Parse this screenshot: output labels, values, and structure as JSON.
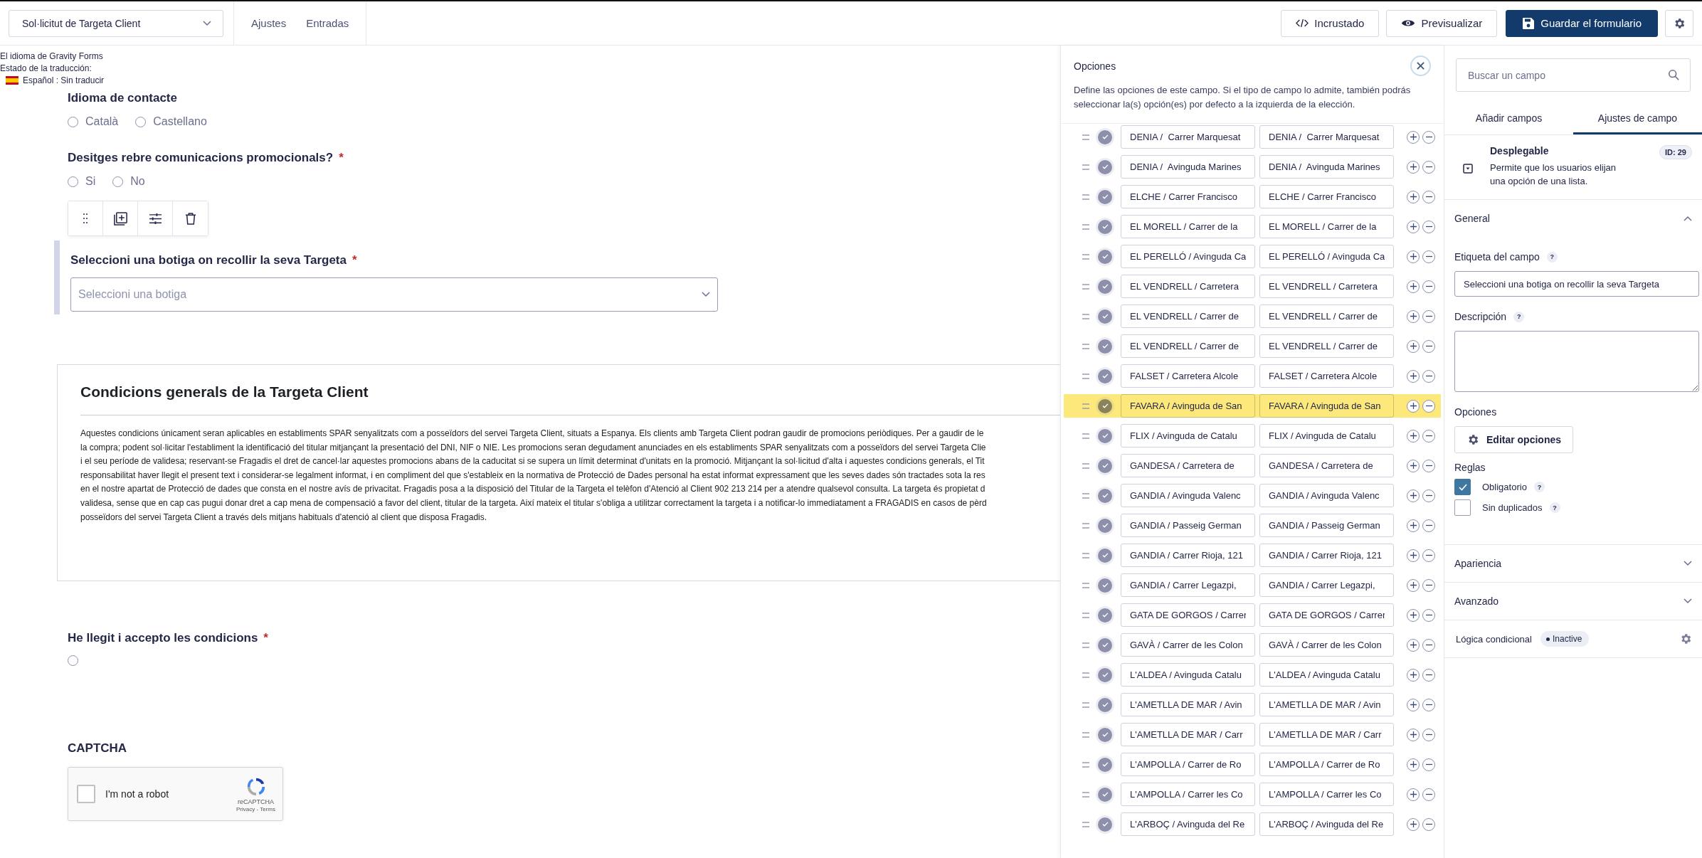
{
  "top_bar": {
    "form_selector": "Sol·licitut de Targeta Client",
    "nav": [
      {
        "label": "Ajustes"
      },
      {
        "label": "Entradas"
      }
    ],
    "buttons": [
      {
        "kind": "embed",
        "label": "Incrustado"
      },
      {
        "kind": "preview",
        "label": "Previsualizar"
      },
      {
        "kind": "save",
        "label": "Guardar el formulario"
      }
    ]
  },
  "translation_info": {
    "language_line": "El idioma de Gravity Forms",
    "status_label": "Estado de la traducción:",
    "status": "Español : Sin traducir"
  },
  "form": {
    "fields": [
      {
        "kind": "radio",
        "label": "Idioma de contacte",
        "selected": false,
        "options": [
          {
            "label": "Català",
            "selected": false
          },
          {
            "label": "Castellano",
            "selected": false
          }
        ]
      },
      {
        "kind": "radio",
        "label": "Desitges rebre comunicacions promocionals?",
        "required_mark": "*",
        "selected": false,
        "options": [
          {
            "label": "Si",
            "selected": false
          },
          {
            "label": "No",
            "selected": false
          }
        ]
      },
      {
        "kind": "select",
        "label": "Seleccioni una botiga on recollir la seva Targeta",
        "required_mark": "*",
        "selected": true,
        "placeholder": "Seleccioni una botiga"
      },
      {
        "kind": "html",
        "title": "Condicions generals de la Targeta Client",
        "selected": false,
        "lines": [
          "Aquestes condicions únicament seran aplicables en establiments SPAR senyalitzats com a posseïdors del servei Targeta Client, situats a Espanya. Els clients amb Targeta Client podran gaudir de promocions periòdiques. Per a gaudir de le",
          "la compra; podent sol·licitar l'establiment la identificació del titular mitjançant la presentació del DNI, NIF o NIE. Les promocions seran degudament anunciades en els establiments SPAR senyalitzats com a posseïdors del servei Targeta Clie",
          "i el seu període de validesa; reservant-se Fragadis el dret de cancel·lar aquestes promocions abans de la caducitat si se supera un límit determinat d'unitats en la promoció. Mitjançant la sol·licitud d'alta i aquestes condicions generals, el Tit",
          "responsabilitat haver llegit el present text i considerar-se legalment informat, i en compliment del que s'estableix en la normativa de Protecció de Dades personal ha estat informat expressament que les seves dades són tractades sota la res",
          "en el nostre apartat de Protecció de dades que consta en el nostre avís de privacitat. Fragadis posa a la disposició del Titular de la Targeta el telèfon d'Atenció al Client 902 213 214 per a atendre qualsevol consulta. La targeta és propietat d",
          "validesa, sense que en cap cas pugui donar dret a cap mena de compensació a favor del client, titular de la targeta. Així mateix el titular s'obliga a utilitzar correctament la targeta i a notificar-lo immediatament a FRAGADIS en casos de pèrd",
          "posseïdors del servei Targeta Client a través dels mitjans habituals d'atenció al client que disposa Fragadis."
        ]
      },
      {
        "kind": "radio",
        "label": "He llegit i accepto les condicions",
        "required_mark": "*",
        "selected": false,
        "options": [
          {
            "selected": false
          }
        ]
      },
      {
        "kind": "captcha",
        "label": "CAPTCHA",
        "selected": false,
        "checkbox_label": "I'm not a robot",
        "brand": "reCAPTCHA",
        "links": "Privacy - Terms"
      }
    ]
  },
  "options_panel": {
    "title": "Opciones",
    "description": "Define las opciones de este campo. Si el tipo de campo lo admite, también podrás seleccionar la(s) opción(es) por defecto a la izquierda de la elección.",
    "choices": [
      {
        "label": "DENIA /  Carrer Marquesat",
        "value": "DENIA /  Carrer Marquesat",
        "selected": false
      },
      {
        "label": "DENIA /  Avinguda Marines",
        "value": "DENIA /  Avinguda Marines",
        "selected": false
      },
      {
        "label": "ELCHE / Carrer Francisco",
        "value": "ELCHE / Carrer Francisco",
        "selected": false
      },
      {
        "label": "EL MORELL / Carrer de la",
        "value": "EL MORELL / Carrer de la",
        "selected": false
      },
      {
        "label": "EL PERELLÓ / Avinguda Ca",
        "value": "EL PERELLÓ / Avinguda Ca",
        "selected": false
      },
      {
        "label": "EL VENDRELL / Carretera",
        "value": "EL VENDRELL / Carretera",
        "selected": false
      },
      {
        "label": "EL VENDRELL / Carrer de",
        "value": "EL VENDRELL / Carrer de",
        "selected": false
      },
      {
        "label": "EL VENDRELL / Carrer de",
        "value": "EL VENDRELL / Carrer de",
        "selected": false
      },
      {
        "label": "FALSET / Carretera Alcole",
        "value": "FALSET / Carretera Alcole",
        "selected": false
      },
      {
        "label": "FAVARA / Avinguda de San",
        "value": "FAVARA / Avinguda de San",
        "selected": true
      },
      {
        "label": "FLIX / Avinguda de Catalu",
        "value": "FLIX / Avinguda de Catalu",
        "selected": false
      },
      {
        "label": "GANDESA / Carretera de",
        "value": "GANDESA / Carretera de",
        "selected": false
      },
      {
        "label": "GANDIA / Avinguda Valenc",
        "value": "GANDIA / Avinguda Valenc",
        "selected": false
      },
      {
        "label": "GANDIA / Passeig German",
        "value": "GANDIA / Passeig German",
        "selected": false
      },
      {
        "label": "GANDIA / Carrer Rioja, 121",
        "value": "GANDIA / Carrer Rioja, 121",
        "selected": false
      },
      {
        "label": "GANDIA / Carrer Legazpi,",
        "value": "GANDIA / Carrer Legazpi,",
        "selected": false
      },
      {
        "label": "GATA DE GORGOS / Carrer",
        "value": "GATA DE GORGOS / Carrer",
        "selected": false
      },
      {
        "label": "GAVÀ / Carrer de les Colon",
        "value": "GAVÀ / Carrer de les Colon",
        "selected": false
      },
      {
        "label": "L'ALDEA / Avinguda Catalu",
        "value": "L'ALDEA / Avinguda Catalu",
        "selected": false
      },
      {
        "label": "L'AMETLLA DE MAR / Avin",
        "value": "L'AMETLLA DE MAR / Avin",
        "selected": false
      },
      {
        "label": "L'AMETLLA DE MAR / Carr",
        "value": "L'AMETLLA DE MAR / Carr",
        "selected": false
      },
      {
        "label": "L'AMPOLLA / Carrer de Ro",
        "value": "L'AMPOLLA / Carrer de Ro",
        "selected": false
      },
      {
        "label": "L'AMPOLLA / Carrer les Co",
        "value": "L'AMPOLLA / Carrer les Co",
        "selected": false
      },
      {
        "label": "L'ARBOÇ / Avinguda del Re",
        "value": "L'ARBOÇ / Avinguda del Re",
        "selected": false
      }
    ]
  },
  "sidebar": {
    "search": {
      "placeholder": "Buscar un campo"
    },
    "tabs": [
      {
        "label": "Añadir campos",
        "selected": false
      },
      {
        "label": "Ajustes de campo",
        "selected": true
      }
    ],
    "field_type": {
      "name": "Desplegable",
      "description": "Permite que los usuarios elijan una opción de una lista.",
      "id_badge": "ID: 29"
    },
    "general": {
      "title": "General",
      "expanded": true,
      "label_field": {
        "label": "Etiqueta del campo",
        "help": "?",
        "value": "Seleccioni una botiga on recollir la seva Targeta"
      },
      "description_field": {
        "label": "Descripción",
        "help": "?"
      },
      "options_label": "Opciones",
      "edit_button": "Editar opciones",
      "rules_label": "Reglas",
      "rules": [
        {
          "label": "Obligatorio",
          "help": "?",
          "checked": true
        },
        {
          "label": "Sin duplicados",
          "help": "?",
          "checked": false
        }
      ]
    },
    "sections": [
      {
        "title": "Apariencia",
        "expanded": false
      },
      {
        "title": "Avanzado",
        "expanded": false
      }
    ],
    "conditional_logic": {
      "title": "Lógica condicional",
      "status": "Inactive"
    }
  }
}
